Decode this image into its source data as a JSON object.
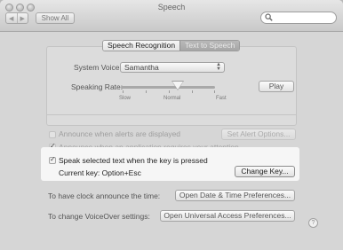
{
  "window": {
    "title": "Speech"
  },
  "toolbar": {
    "show_all": "Show All",
    "back_icon": "chevron-left-icon",
    "forward_icon": "chevron-right-icon"
  },
  "search": {
    "value": "",
    "placeholder": ""
  },
  "tabs": [
    {
      "label": "Speech Recognition",
      "active": true
    },
    {
      "label": "Text to Speech",
      "active": false
    }
  ],
  "voice": {
    "label": "System Voice:",
    "selected": "Samantha"
  },
  "rate": {
    "label": "Speaking Rate:",
    "marks": [
      "Slow",
      "Normal",
      "Fast"
    ],
    "play_label": "Play",
    "level": 0.55
  },
  "options": {
    "alerts": {
      "label": "Announce when alerts are displayed",
      "checked": false,
      "button": "Set Alert Options..."
    },
    "attention": {
      "label": "Announce when an application requires your attention",
      "checked": true
    },
    "speak_selected": {
      "label": "Speak selected text when the key is pressed",
      "checked": true,
      "current_key": "Current key: Option+Esc",
      "button": "Change Key..."
    }
  },
  "clock": {
    "label": "To have clock announce the time:",
    "button": "Open Date & Time Preferences..."
  },
  "voiceover": {
    "label": "To change VoiceOver settings:",
    "button": "Open Universal Access Preferences..."
  },
  "help": {
    "glyph": "?"
  }
}
